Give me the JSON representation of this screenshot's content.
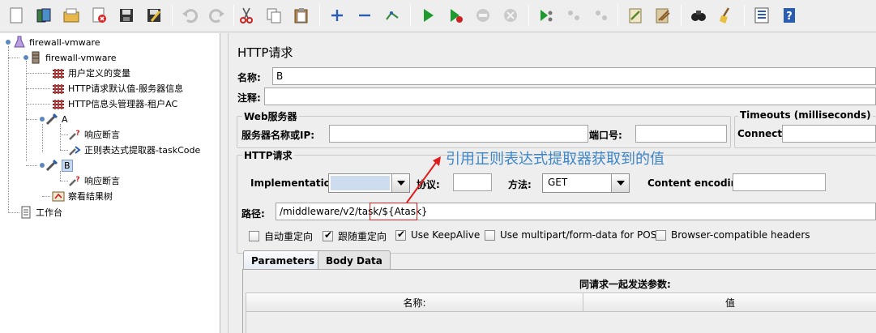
{
  "toolbar": {
    "buttons": [
      {
        "name": "new-icon",
        "tip": "new"
      },
      {
        "name": "templates-icon"
      },
      {
        "name": "open-icon"
      },
      {
        "name": "close-icon"
      },
      {
        "name": "save-icon"
      },
      {
        "name": "save-as-icon"
      },
      {
        "name": "undo-icon"
      },
      {
        "name": "redo-icon"
      },
      {
        "name": "cut-icon"
      },
      {
        "name": "copy-icon"
      },
      {
        "name": "paste-icon"
      },
      {
        "name": "expand-icon"
      },
      {
        "name": "collapse-icon"
      },
      {
        "name": "toggle-icon"
      },
      {
        "name": "start-icon"
      },
      {
        "name": "start-no-pause-icon"
      },
      {
        "name": "stop-icon"
      },
      {
        "name": "shutdown-icon"
      },
      {
        "name": "remote-start-icon"
      },
      {
        "name": "remote-stop-icon"
      },
      {
        "name": "remote-shutdown-icon"
      },
      {
        "name": "clear-icon"
      },
      {
        "name": "clear-all-icon"
      },
      {
        "name": "search-icon"
      },
      {
        "name": "reset-search-icon"
      },
      {
        "name": "function-helper-icon"
      },
      {
        "name": "help-icon"
      }
    ]
  },
  "tree": {
    "root": "firewall-vmware",
    "thread_group": "firewall-vmware",
    "items": [
      {
        "label": "用户定义的变量"
      },
      {
        "label": "HTTP请求默认值-服务器信息"
      },
      {
        "label": "HTTP信息头管理器-租户AC"
      },
      {
        "label": "A"
      },
      {
        "label": "响应断言"
      },
      {
        "label": "正则表达式提取器-taskCode"
      },
      {
        "label": "B"
      },
      {
        "label": "响应断言"
      },
      {
        "label": "察看结果树"
      }
    ],
    "workbench": "工作台"
  },
  "panel": {
    "title": "HTTP请求",
    "name_label": "名称:",
    "name_value": "B",
    "comment_label": "注释:",
    "comment_value": "",
    "web_server_legend": "Web服务器",
    "server_label": "服务器名称或IP:",
    "server_value": "",
    "port_label": "端口号:",
    "port_value": "",
    "timeouts_legend": "Timeouts (milliseconds)",
    "connect_label": "Connect:",
    "connect_value": "",
    "http_legend": "HTTP请求",
    "impl_label": "Implementation:",
    "impl_value": "",
    "protocol_label": "协议:",
    "protocol_value": "",
    "method_label": "方法:",
    "method_value": "GET",
    "encoding_label": "Content encoding:",
    "encoding_value": "",
    "path_label": "路径:",
    "path_prefix": "/middleware/v2/task/",
    "path_var": "${Atask}",
    "checkboxes": [
      {
        "label": "自动重定向",
        "checked": false
      },
      {
        "label": "跟随重定向",
        "checked": true
      },
      {
        "label": "Use KeepAlive",
        "checked": true
      },
      {
        "label": "Use multipart/form-data for POST",
        "checked": false
      },
      {
        "label": "Browser-compatible headers",
        "checked": false
      }
    ],
    "tabs": [
      {
        "label": "Parameters",
        "active": true
      },
      {
        "label": "Body Data",
        "active": false
      }
    ],
    "params_caption": "同请求一起发送参数:",
    "col_name": "名称:",
    "col_value": "值"
  },
  "annotation": {
    "text": "引用正则表达式提取器获取到的值",
    "color": "#3f86c8",
    "arrow_color": "#e01c1c"
  }
}
